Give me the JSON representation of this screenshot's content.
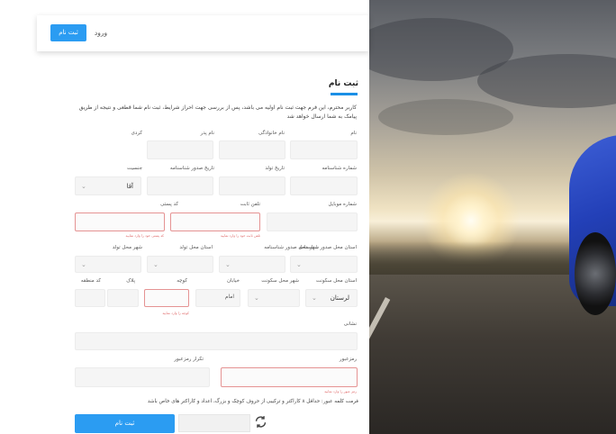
{
  "topbar": {
    "signup_label": "ثبت نام",
    "login_label": "ورود"
  },
  "form": {
    "title": "ثبت نام",
    "intro": "کاربر محترم، این فرم جهت ثبت نام اولیه می باشد، پس از بررسی جهت احراز شرایط، ثبت نام شما قطعی و نتیجه از طریق پیامک به شما ارسال خواهد شد",
    "labels": {
      "first_name": "نام",
      "last_name": "نام خانوادگی",
      "father_name": "نام پدر",
      "kurdi": "کردی",
      "id_number": "شماره شناسنامه",
      "birth_date": "تاریخ تولد",
      "id_issue_date": "تاریخ صدور شناسنامه",
      "gender": "جنسیت",
      "mobile": "شماره موبایل",
      "landline": "تلفن ثابت",
      "postal_code": "کد پستی",
      "id_issue_province": "استان محل صدور شناسنامه",
      "id_issue_city": "شهر محل صدور شناسنامه",
      "birth_province": "استان محل تولد",
      "birth_city": "شهر محل تولد",
      "residence_province": "استان محل سکونت",
      "residence_city": "شهر محل سکونت",
      "street": "خیابان",
      "alley": "کوچه",
      "plaque": "پلاک",
      "area_code": "کد منطقه",
      "address": "نشانی",
      "password": "رمزعبور",
      "password_repeat": "تکرار رمزعبور"
    },
    "values": {
      "gender": "آقا",
      "residence_province": "لرستان",
      "street_prefix": "امام"
    },
    "errors": {
      "landline": "تلفن ثابت خود را وارد نمایید",
      "postal_code": "کد پستی خود را وارد نمایید",
      "alley": "کوچه را وارد نمایید",
      "password": "رمز عبور را وارد نمایید"
    },
    "password_note": "فرمت کلمه عبور: حداقل ۸ کاراکتر و ترکیبی از حروف کوچک و بزرگ، اعداد و کاراکتر های خاص باشد",
    "submit_label": "ثبت نام"
  },
  "icons": {
    "refresh": "refresh-icon",
    "chevron": "chevron-down-icon"
  },
  "colors": {
    "accent": "#2b9cf2",
    "error": "#e06b6b",
    "title_bar": "#1a8fe6"
  }
}
